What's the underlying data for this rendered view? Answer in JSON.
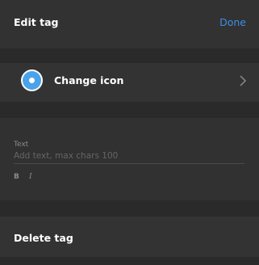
{
  "header": {
    "title": "Edit tag",
    "done_label": "Done"
  },
  "icon_row": {
    "label": "Change icon",
    "icon": "radio-dot-icon",
    "chevron_icon": "chevron-right-icon"
  },
  "text_section": {
    "label": "Text",
    "value": "",
    "placeholder": "Add text, max chars 100",
    "bold_label": "B",
    "italic_label": "I"
  },
  "delete_row": {
    "label": "Delete tag"
  },
  "colors": {
    "accent": "#3b8fe6",
    "icon_fill": "#4aa3ea",
    "background": "#2f2f2f"
  }
}
